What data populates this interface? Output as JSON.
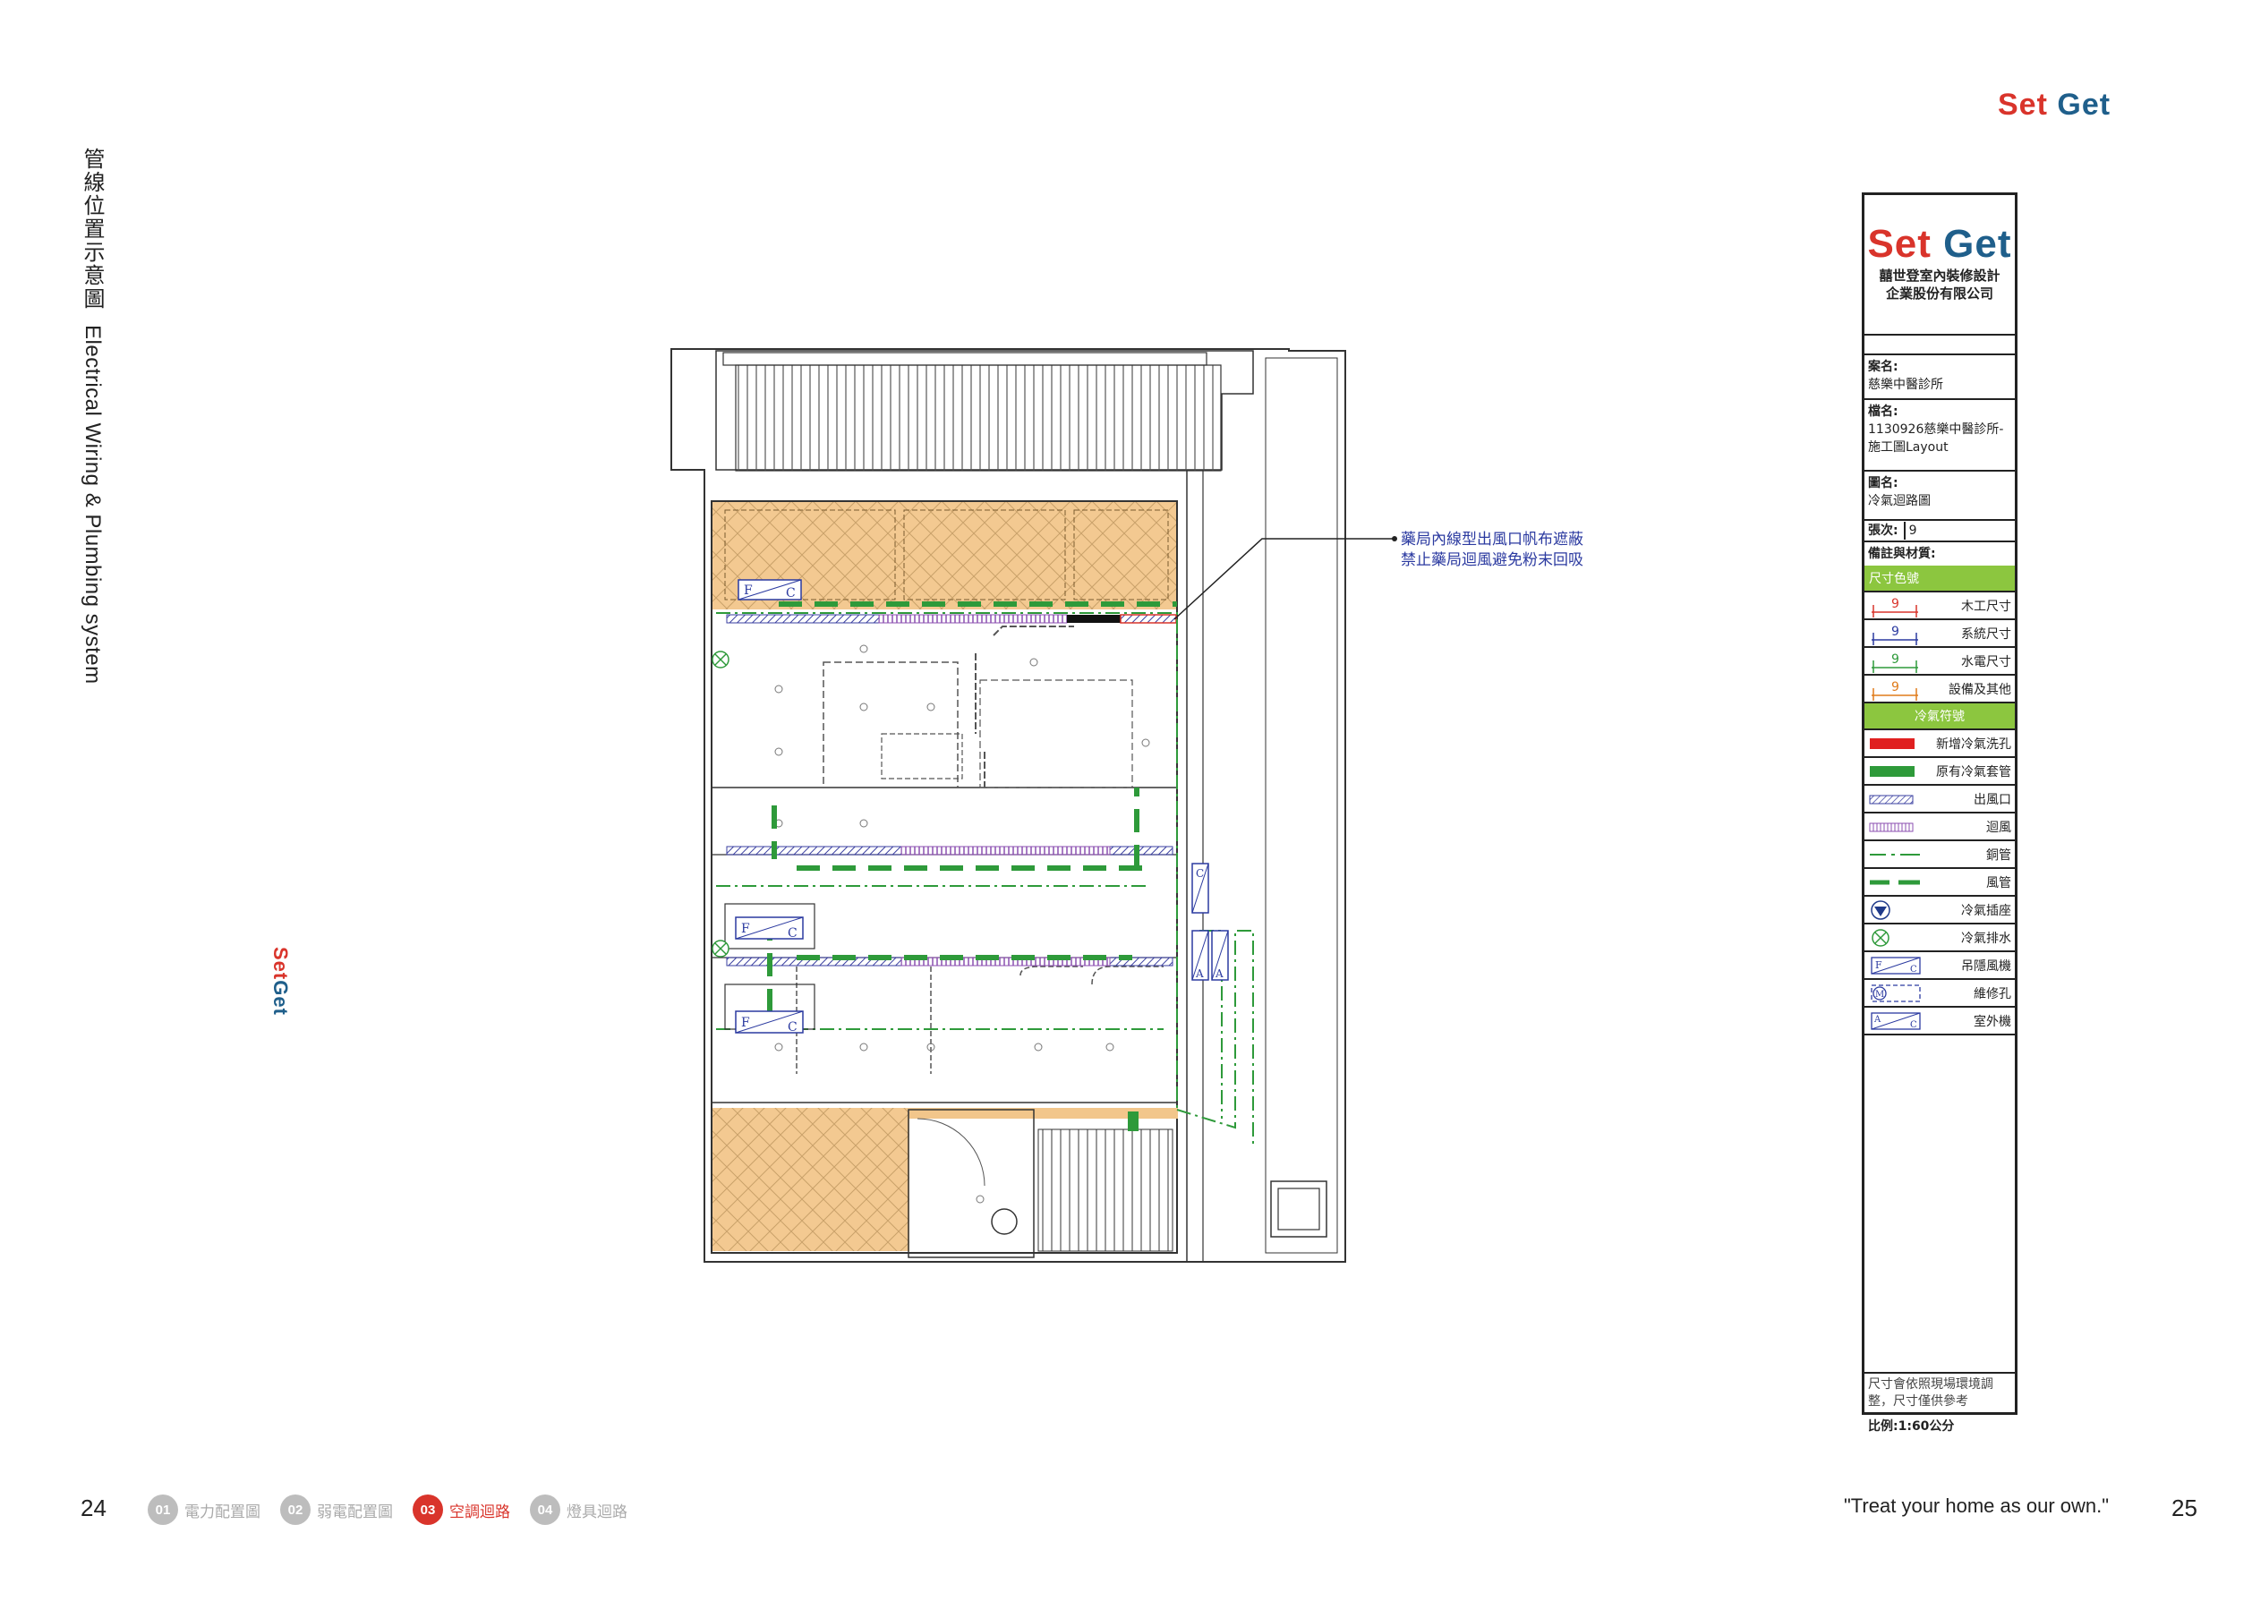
{
  "brand": {
    "part1": "Set",
    "part2": "Get"
  },
  "title": {
    "zh": "管線位置示意圖",
    "en": "Electrical Wiring & Plumbing system"
  },
  "annotation": {
    "line1": "藥局內線型出風口帆布遮蔽",
    "line2": "禁止藥局迴風避免粉末回吸"
  },
  "title_block": {
    "company_line1": "囍世登室內裝修設計",
    "company_line2": "企業股份有限公司",
    "project_label": "案名:",
    "project_value": "慈樂中醫診所",
    "file_label": "檔名:",
    "file_value": "1130926慈樂中醫診所-施工圖Layout",
    "drawing_label": "圖名:",
    "drawing_value": "冷氣迴路圖",
    "sheet_label": "張次:",
    "sheet_value": "9",
    "remarks_label": "備註與材質:",
    "dim_header": "尺寸色號",
    "dim_rows": [
      {
        "num": "9",
        "label": "木工尺寸",
        "color": "#d9342b"
      },
      {
        "num": "9",
        "label": "系統尺寸",
        "color": "#2b3aa0"
      },
      {
        "num": "9",
        "label": "水電尺寸",
        "color": "#2e9a3a"
      },
      {
        "num": "9",
        "label": "設備及其他",
        "color": "#e07b1a"
      }
    ],
    "ac_header": "冷氣符號",
    "ac_rows": [
      {
        "label": "新增冷氣洗孔",
        "icon": "red-bar-icon"
      },
      {
        "label": "原有冷氣套管",
        "icon": "green-bar-icon"
      },
      {
        "label": "出風口",
        "icon": "supply-vent-icon"
      },
      {
        "label": "迴風",
        "icon": "return-vent-icon"
      },
      {
        "label": "銅管",
        "icon": "copper-pipe-icon"
      },
      {
        "label": "風管",
        "icon": "air-duct-icon"
      },
      {
        "label": "冷氣插座",
        "icon": "ac-socket-icon"
      },
      {
        "label": "冷氣排水",
        "icon": "ac-drain-icon"
      },
      {
        "label": "吊隱風機",
        "icon": "fan-coil-icon"
      },
      {
        "label": "維修孔",
        "icon": "access-hole-icon"
      },
      {
        "label": "室外機",
        "icon": "outdoor-unit-icon"
      }
    ],
    "note": "尺寸會依照現場環境調整，尺寸僅供參考",
    "scale": "比例:1:60公分"
  },
  "fc_labels": {
    "f": "F",
    "c": "C",
    "a": "A",
    "m": "M"
  },
  "footer": {
    "page_left": "24",
    "page_right": "25",
    "slogan": "\"Treat your home as our own.\"",
    "nav": [
      {
        "num": "01",
        "label": "電力配置圖"
      },
      {
        "num": "02",
        "label": "弱電配置圖"
      },
      {
        "num": "03",
        "label": "空調迴路"
      },
      {
        "num": "04",
        "label": "燈具迴路"
      }
    ]
  }
}
